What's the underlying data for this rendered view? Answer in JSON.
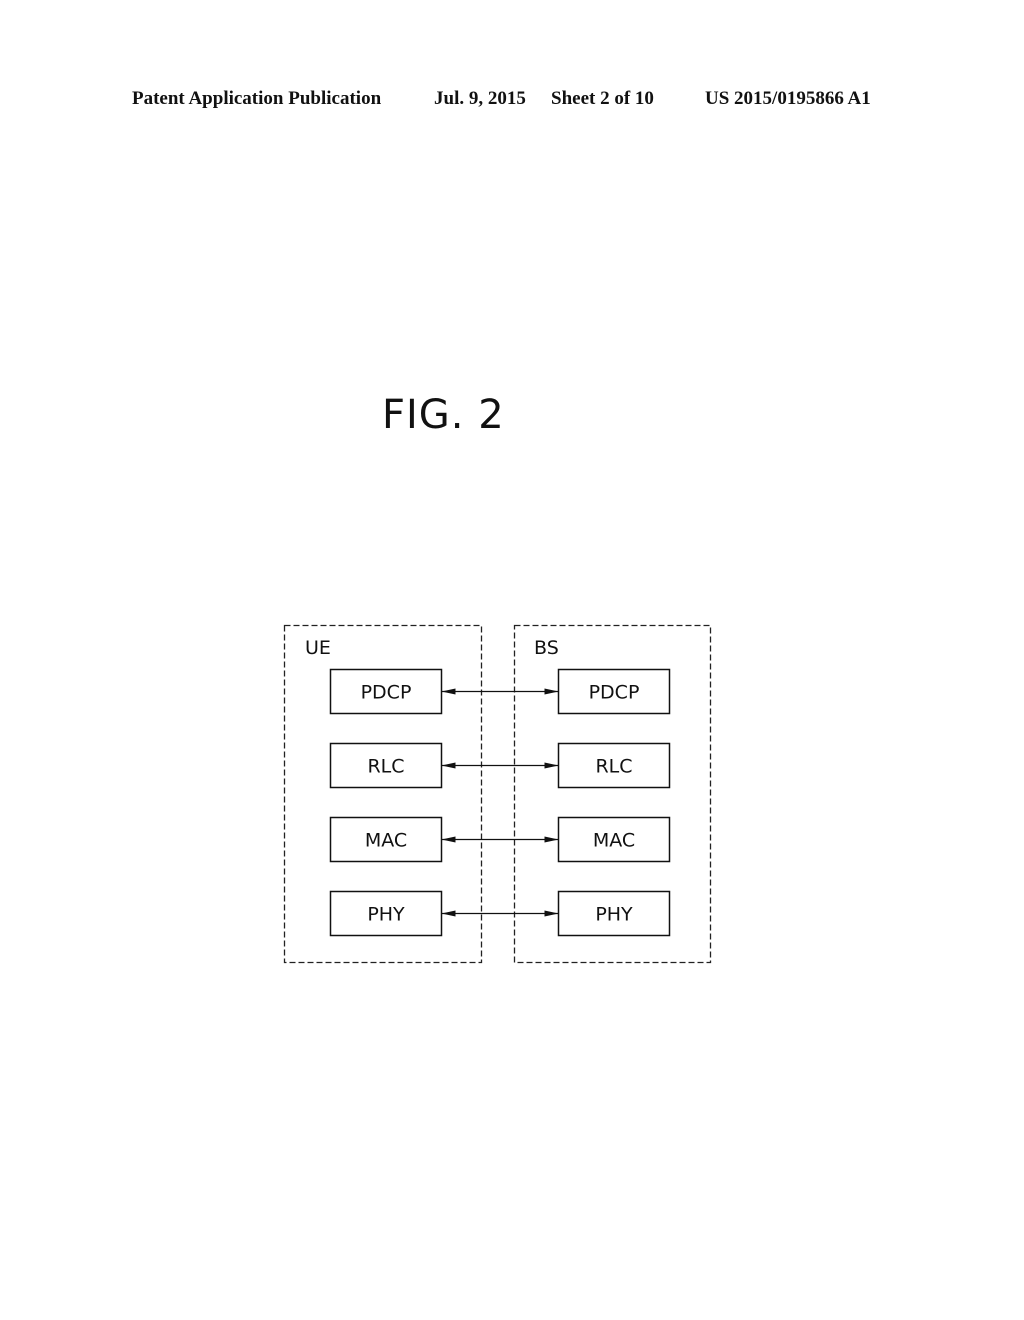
{
  "header": {
    "publication": "Patent Application Publication",
    "date": "Jul. 9, 2015",
    "sheet": "Sheet 2 of 10",
    "number": "US 2015/0195866 A1"
  },
  "figure": {
    "title": "FIG. 2"
  },
  "diagram": {
    "groups": [
      {
        "label": "UE",
        "layers": [
          "PDCP",
          "RLC",
          "MAC",
          "PHY"
        ]
      },
      {
        "label": "BS",
        "layers": [
          "PDCP",
          "RLC",
          "MAC",
          "PHY"
        ]
      }
    ],
    "connections": [
      {
        "from": "UE.PDCP",
        "to": "BS.PDCP",
        "type": "bidirectional"
      },
      {
        "from": "UE.RLC",
        "to": "BS.RLC",
        "type": "bidirectional"
      },
      {
        "from": "UE.MAC",
        "to": "BS.MAC",
        "type": "bidirectional"
      },
      {
        "from": "UE.PHY",
        "to": "BS.PHY",
        "type": "bidirectional"
      }
    ]
  }
}
